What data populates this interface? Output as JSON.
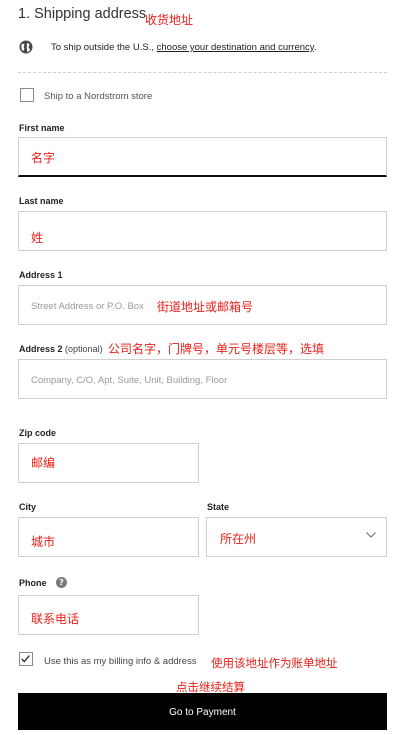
{
  "section": {
    "title": "1. Shipping address",
    "note": "收货地址"
  },
  "intl": {
    "text": "To ship outside the U.S., ",
    "link": "choose your destination and currency",
    "suffix": "."
  },
  "store": {
    "label": "Ship to a Nordstrom store",
    "checked": false
  },
  "first_name": {
    "label": "First name",
    "value": "名字"
  },
  "last_name": {
    "label": "Last name",
    "value": "姓"
  },
  "address1": {
    "label": "Address 1",
    "placeholder": "Street Address or P.O. Box",
    "note": "街道地址或邮箱号"
  },
  "address2": {
    "label": "Address 2",
    "optional": "(optional)",
    "note": "公司名字，门牌号，单元号楼层等，选填",
    "placeholder": "Company, C/O, Apt, Suite, Unit, Building, Floor"
  },
  "zip": {
    "label": "Zip code",
    "value": "邮编"
  },
  "city": {
    "label": "City",
    "value": "城市"
  },
  "state": {
    "label": "State",
    "value": "所在州"
  },
  "phone": {
    "label": "Phone",
    "help_icon": "?",
    "value": "联系电话"
  },
  "billing": {
    "label": "Use this as my billing info & address",
    "note": "使用该地址作为账单地址",
    "checked": true
  },
  "payment": {
    "note": "点击继续结算",
    "button_label": "Go to Payment"
  },
  "colors": {
    "annotation": "#e8201a",
    "button_bg": "#000000",
    "focus_border": "#111111"
  }
}
